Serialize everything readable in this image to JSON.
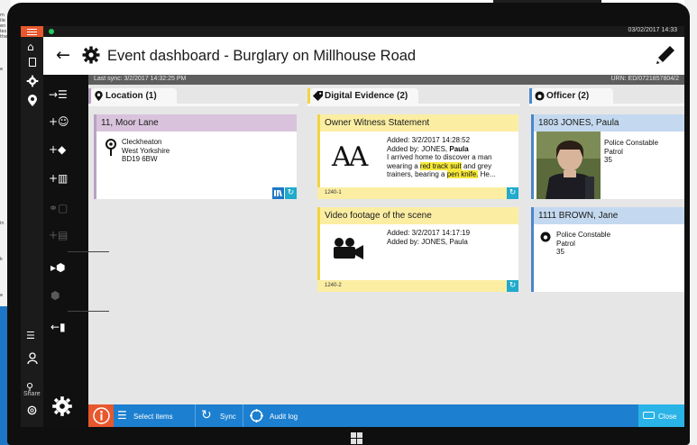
{
  "background": {
    "left_text": [
      "m",
      "ile",
      "en",
      "les",
      "the",
      "e",
      "in",
      "k",
      "e"
    ]
  },
  "status": {
    "time": "03/02/2017 14:33",
    "online_color": "#27c95a"
  },
  "header": {
    "title": "Event dashboard - Burglary on Millhouse Road"
  },
  "infobar": {
    "last_sync": "Last sync: 3/2/2017 14:32:25 PM",
    "urn": "URN: ED/0721857804/2"
  },
  "nav": {
    "primary": [
      "home-icon",
      "document-icon",
      "gear-icon",
      "location-pin-icon",
      "list-icon",
      "user-icon",
      "search-user-icon",
      "settings-icon"
    ],
    "secondary": [
      "add-list-icon",
      "add-person-icon",
      "add-tag-icon",
      "add-library-icon",
      "link-copy-icon",
      "add-note-icon",
      "expand-cube-icon",
      "cube-icon",
      "new-document-icon",
      "share-gear-icon"
    ],
    "share_label": "Share"
  },
  "columns": {
    "location": {
      "title": "Location (1)",
      "accent": "#b8a2c2"
    },
    "evidence": {
      "title": "Digital Evidence (2)",
      "accent": "#f0d540"
    },
    "officer": {
      "title": "Officer (2)",
      "accent": "#4a86c8"
    }
  },
  "location_card": {
    "title": "11, Moor Lane",
    "line1": "Cleckheaton",
    "line2": "West Yorkshire",
    "line3": "BD19 6BW"
  },
  "evidence_cards": [
    {
      "title": "Owner Witness Statement",
      "added": "Added: 3/2/2017  14:28:52",
      "added_by_prefix": "Added by: JONES, ",
      "added_by_name": "Paula",
      "desc_1": "I arrived home to discover a man",
      "desc_2a": "wearing a ",
      "desc_2b": "red track suit",
      "desc_2c": " and grey",
      "desc_3a": "trainers, bearing a ",
      "desc_3b": "pen knife.",
      "desc_3c": " He...",
      "glyph": "AA",
      "ref": "1240-1"
    },
    {
      "title": "Video footage of the scene",
      "added": "Added: 3/2/2017  14:17:19",
      "added_by": "Added by: JONES, Paula",
      "ref": "1240-2"
    }
  ],
  "officer_cards": [
    {
      "title": "1803 JONES, Paula",
      "role1": "Police Constable",
      "role2": "Patrol",
      "num": "35"
    },
    {
      "title": "1111 BROWN, Jane",
      "role1": "Police Constable",
      "role2": "Patrol",
      "num": "35"
    }
  ],
  "bottombar": {
    "select": "Select items",
    "sync": "Sync",
    "audit": "Audit log",
    "close": "Close"
  }
}
